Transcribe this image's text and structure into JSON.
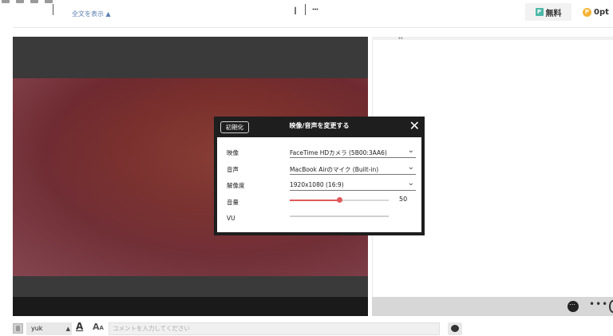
{
  "header": {
    "show_all": "全文を表示 ▲",
    "badge_free_icon": "P",
    "badge_free_label": "無料",
    "badge_points_icon": "P",
    "badge_points_label": "0pt"
  },
  "dialog": {
    "reset_label": "初期化",
    "title": "映像/音声を変更する",
    "close_label": "✕",
    "rows": [
      {
        "label": "映像",
        "value": "FaceTime HDカメラ (5B00:3AA6)"
      },
      {
        "label": "音声",
        "value": "MacBook Airのマイク (Built-in)"
      },
      {
        "label": "解像度",
        "value": "1920x1080 (16:9)"
      }
    ],
    "volume_label": "音量",
    "volume_value": "50",
    "volume_fraction": 0.5,
    "vu_label": "VU",
    "vu_fraction": 0.0,
    "accent_color": "#e05a5a"
  },
  "controls": {
    "icons": [
      "refresh-icon",
      "gear-icon",
      "microphone-icon",
      "gift-icon",
      "comment-icon",
      "layout-icon",
      "fullscreen-icon"
    ]
  },
  "comment_bar": {
    "username": "yuk",
    "text_color_label": "A",
    "font_size_label": "A",
    "placeholder": "コメントを入力してください"
  }
}
